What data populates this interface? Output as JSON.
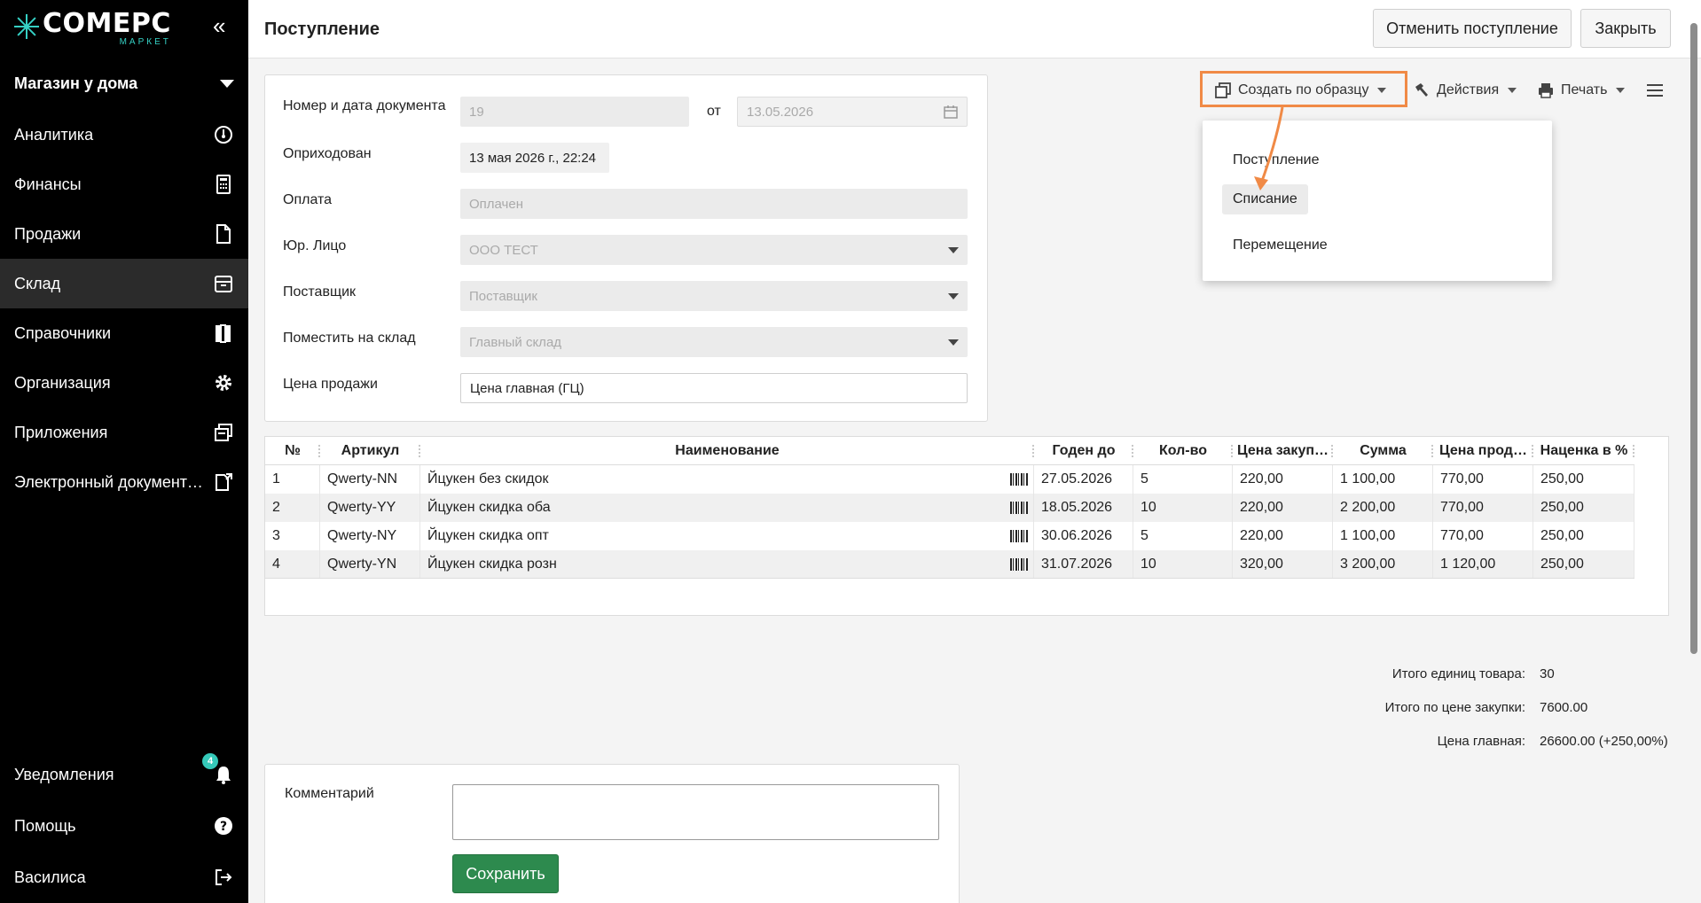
{
  "logo": {
    "title": "COMEPC",
    "subtitle": "МАРКЕТ"
  },
  "store": {
    "name": "Магазин у дома"
  },
  "nav": [
    {
      "label": "Аналитика",
      "icon": "speedometer-icon"
    },
    {
      "label": "Финансы",
      "icon": "calculator-icon"
    },
    {
      "label": "Продажи",
      "icon": "document-icon"
    },
    {
      "label": "Склад",
      "icon": "box-icon",
      "active": true
    },
    {
      "label": "Справочники",
      "icon": "books-icon"
    },
    {
      "label": "Организация",
      "icon": "gear-icon"
    },
    {
      "label": "Приложения",
      "icon": "windows-icon"
    },
    {
      "label": "Электронный документо…",
      "icon": "edoc-icon"
    }
  ],
  "nav_bottom": {
    "notifications": {
      "label": "Уведомления",
      "badge": "4"
    },
    "help": {
      "label": "Помощь"
    },
    "user": {
      "label": "Василиса"
    }
  },
  "header": {
    "title": "Поступление",
    "cancel_label": "Отменить поступление",
    "close_label": "Закрыть"
  },
  "toolbar": {
    "create_label": "Создать по образцу",
    "actions_label": "Действия",
    "print_label": "Печать"
  },
  "dropdown": {
    "items": [
      "Поступление",
      "Списание",
      "Перемещение"
    ],
    "hovered": "Списание"
  },
  "form": {
    "doc_label": "Номер и дата документа",
    "doc_number": "19",
    "from_label": "от",
    "doc_date": "13.05.2026",
    "posted_label": "Оприходован",
    "posted_value": "13 мая 2026 г., 22:24",
    "payment_label": "Оплата",
    "payment_value": "Оплачен",
    "entity_label": "Юр. Лицо",
    "entity_value": "ООО ТЕСТ",
    "supplier_label": "Поставщик",
    "supplier_placeholder": "Поставщик",
    "warehouse_label": "Поместить на склад",
    "warehouse_value": "Главный склад",
    "price_label": "Цена продажи",
    "price_value": "Цена главная (ГЦ)"
  },
  "table": {
    "headers": [
      "№",
      "Артикул",
      "Наименование",
      "Годен до",
      "Кол-во",
      "Цена закуп…",
      "Сумма",
      "Цена прод…",
      "Наценка в %"
    ],
    "rows": [
      [
        "1",
        "Qwerty-NN",
        "Йцукен без скидок",
        "27.05.2026",
        "5",
        "220,00",
        "1 100,00",
        "770,00",
        "250,00"
      ],
      [
        "2",
        "Qwerty-YY",
        "Йцукен скидка оба",
        "18.05.2026",
        "10",
        "220,00",
        "2 200,00",
        "770,00",
        "250,00"
      ],
      [
        "3",
        "Qwerty-NY",
        "Йцукен скидка опт",
        "30.06.2026",
        "5",
        "220,00",
        "1 100,00",
        "770,00",
        "250,00"
      ],
      [
        "4",
        "Qwerty-YN",
        "Йцукен скидка розн",
        "31.07.2026",
        "10",
        "320,00",
        "3 200,00",
        "1 120,00",
        "250,00"
      ]
    ]
  },
  "totals": {
    "units_label": "Итого единиц товара:",
    "units_value": "30",
    "purchase_label": "Итого по цене закупки:",
    "purchase_value": "7600.00",
    "main_price_label": "Цена главная:",
    "main_price_value": "26600.00 (+250,00%)"
  },
  "comment": {
    "label": "Комментарий",
    "value": "",
    "save_label": "Сохранить"
  },
  "colors": {
    "accent_teal": "#35d0c4",
    "highlight_orange": "#f08a46",
    "save_green": "#2d8a4e"
  }
}
